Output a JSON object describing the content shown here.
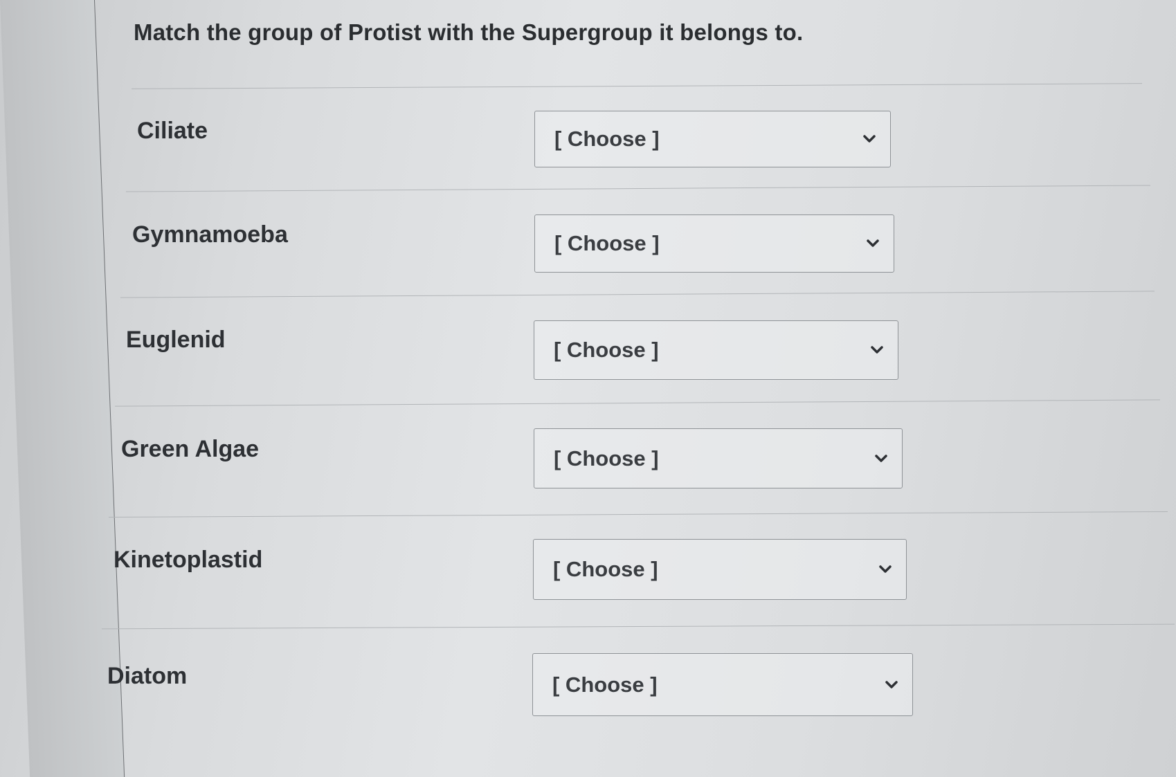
{
  "question": {
    "text": "Match the group of Protist with the Supergroup it belongs to."
  },
  "rows": [
    {
      "label": "Ciliate",
      "select": {
        "value": "[ Choose ]"
      }
    },
    {
      "label": "Gymnamoeba",
      "select": {
        "value": "[ Choose ]"
      }
    },
    {
      "label": "Euglenid",
      "select": {
        "value": "[ Choose ]"
      }
    },
    {
      "label": "Green Algae",
      "select": {
        "value": "[ Choose ]"
      }
    },
    {
      "label": "Kinetoplastid",
      "select": {
        "value": "[ Choose ]"
      }
    },
    {
      "label": "Diatom",
      "select": {
        "value": "[ Choose ]"
      }
    }
  ],
  "icons": {
    "dropdown": "chevron-down-icon"
  },
  "colors": {
    "text": "#2d3034",
    "border": "#8e9296",
    "divider": "#b2b5b8"
  }
}
